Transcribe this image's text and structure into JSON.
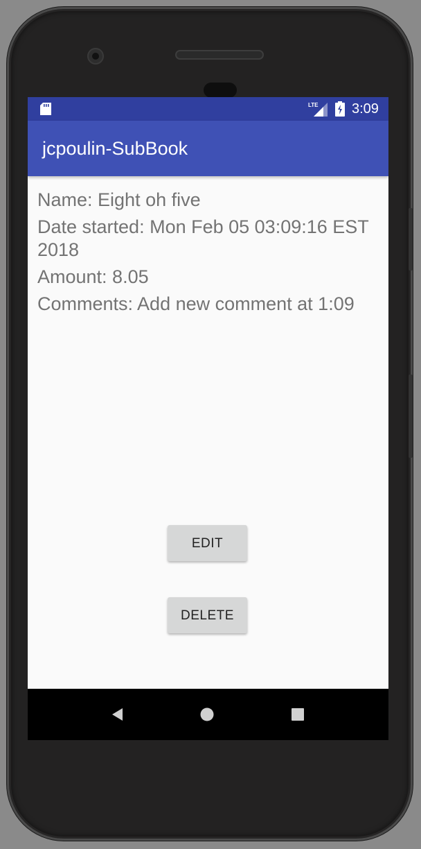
{
  "status_bar": {
    "time": "3:09",
    "network_label": "LTE",
    "icons": [
      "sd-card-icon",
      "lte-signal-icon",
      "battery-charging-icon"
    ]
  },
  "app_bar": {
    "title": "jcpoulin-SubBook",
    "color": "#3f51b5",
    "status_color": "#303f9f"
  },
  "details": {
    "name": "Name: Eight oh five",
    "date_started": "Date started: Mon Feb 05 03:09:16 EST 2018",
    "amount": "Amount: 8.05",
    "comments": "Comments: Add new comment at 1:09"
  },
  "buttons": {
    "edit_label": "EDIT",
    "delete_label": "DELETE"
  },
  "nav_bar": {
    "icons": [
      "back-icon",
      "home-icon",
      "recent-apps-icon"
    ]
  }
}
